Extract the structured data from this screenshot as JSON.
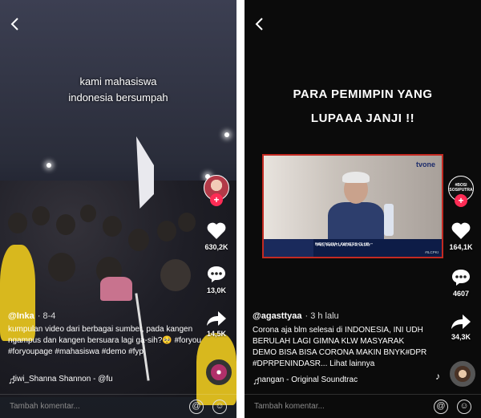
{
  "left": {
    "overlay_lines": [
      "kami mahasiswa",
      "indonesia bersumpah"
    ],
    "likes": "630,2K",
    "comments": "13,0K",
    "shares": "14,5K",
    "username": "@Inka",
    "date": "· 8-4",
    "caption": "kumpulan video dari berbagai sumber, pada kangen ngampus dan kangen bersuara lagi ga-sih?🥺 #foryou #foryoupage #mahasiswa #demo #fyp",
    "sound": "tiwi_Shanna Shannon - @fu",
    "comment_placeholder": "Tambah komentar..."
  },
  "right": {
    "overlay_lines": [
      "PARA PEMIMPIN YANG",
      "LUPAAA JANJI !!"
    ],
    "tv": {
      "logo": "tvone",
      "chyron": "\"PKI, HANTU ATAU RYATAY\"",
      "lawyers": "INDONESIA LAWYERS CLUB",
      "tag": "#ILCPKI"
    },
    "avatar_text": "#BOSI SOSIPUTRA",
    "likes": "164,1K",
    "comments": "4607",
    "shares": "34,3K",
    "username": "@agasttyaa",
    "date": "· 3 h lalu",
    "caption": "Corona aja blm selesai di INDONESIA, INI UDH BERULAH LAGI  GIMNA KLW MASYARAK DEMO BISA BISA CORONA MAKIN BNYK#DPR #DPRPENINDASR... Lihat lainnya",
    "sound": "nangan - Original Soundtrac",
    "comment_placeholder": "Tambah komentar..."
  },
  "icons": {
    "back": "chevron-left-icon",
    "heart": "heart-icon",
    "comment": "comment-icon",
    "share": "share-icon",
    "music": "music-note-icon",
    "mention": "at-icon",
    "emoji": "emoji-icon"
  },
  "colors": {
    "accent": "#fe2c55",
    "background": "#0b0b0b"
  }
}
